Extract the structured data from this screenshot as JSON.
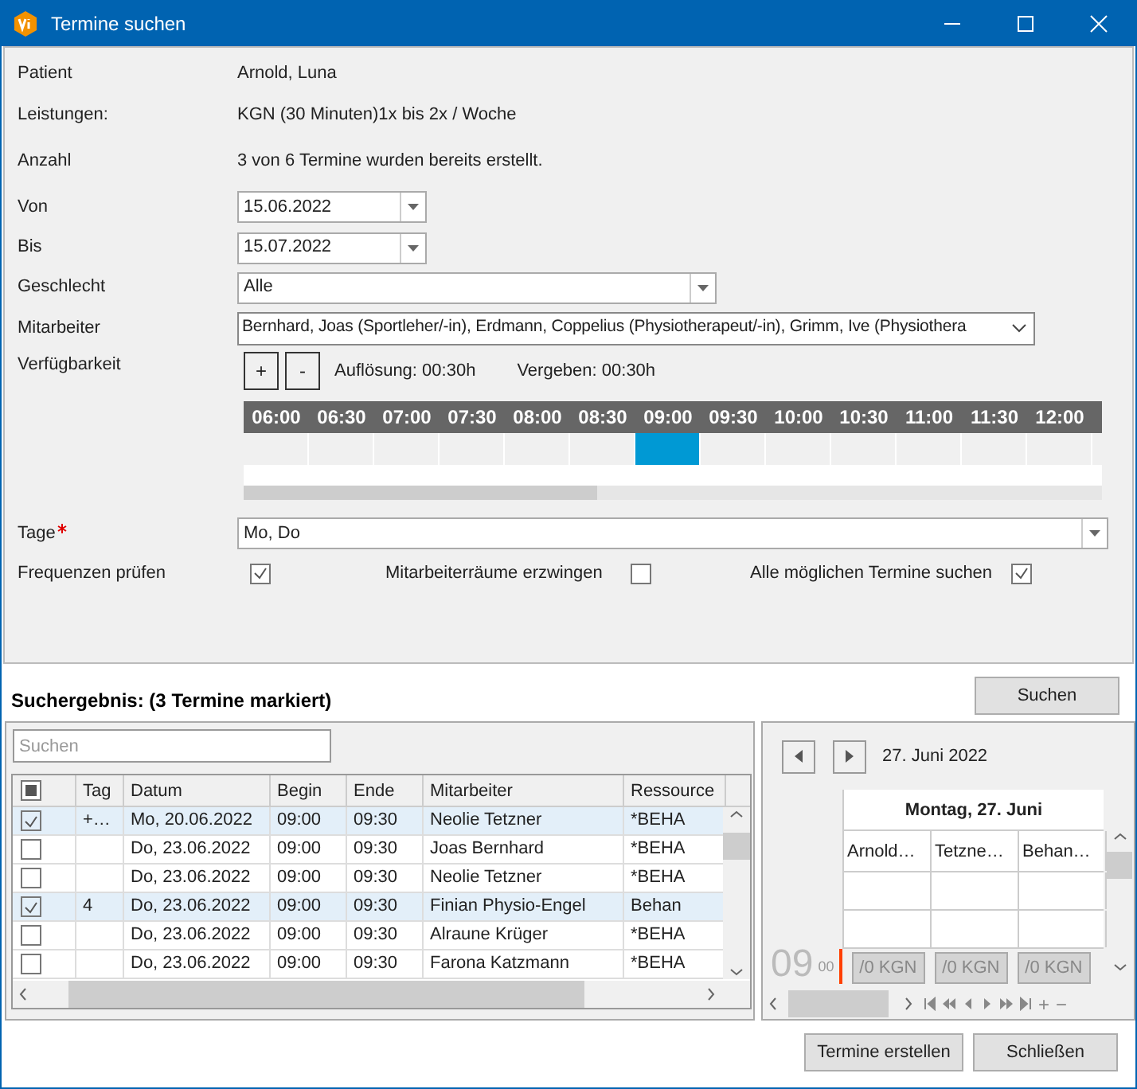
{
  "window": {
    "title": "Termine suchen"
  },
  "info": [
    {
      "label": "Patient",
      "value": "Arnold, Luna"
    },
    {
      "label": "Leistungen:",
      "value": "KGN  (30 Minuten)1x bis 2x / Woche"
    },
    {
      "label": "Anzahl",
      "value": "3 von 6 Termine wurden bereits erstellt."
    }
  ],
  "von": {
    "label": "Von",
    "value": "15.06.2022"
  },
  "bis": {
    "label": "Bis",
    "value": "15.07.2022"
  },
  "geschlecht": {
    "label": "Geschlecht",
    "value": "Alle"
  },
  "mitarbeiter": {
    "label": "Mitarbeiter",
    "value": "Bernhard, Joas (Sportleher/-in), Erdmann, Coppelius (Physiotherapeut/-in), Grimm, Ive (Physiothera"
  },
  "availability": {
    "label": "Verfügbarkeit",
    "buttons": [
      "+",
      "-"
    ],
    "resolution": "Auflösung: 00:30h",
    "assigned": "Vergeben: 00:30h",
    "slots": [
      {
        "time": "06:00",
        "selected": false
      },
      {
        "time": "06:30",
        "selected": false
      },
      {
        "time": "07:00",
        "selected": false
      },
      {
        "time": "07:30",
        "selected": false
      },
      {
        "time": "08:00",
        "selected": false
      },
      {
        "time": "08:30",
        "selected": false
      },
      {
        "time": "09:00",
        "selected": true
      },
      {
        "time": "09:30",
        "selected": false
      },
      {
        "time": "10:00",
        "selected": false
      },
      {
        "time": "10:30",
        "selected": false
      },
      {
        "time": "11:00",
        "selected": false
      },
      {
        "time": "11:30",
        "selected": false
      },
      {
        "time": "12:00",
        "selected": false
      }
    ]
  },
  "tage": {
    "label": "Tage",
    "required": true,
    "value": "Mo, Do"
  },
  "options": [
    {
      "label": "Frequenzen prüfen",
      "checked": true
    },
    {
      "label": "Mitarbeiterräume erzwingen",
      "checked": false
    },
    {
      "label": "Alle möglichen Termine suchen",
      "checked": true
    }
  ],
  "search_button": "Suchen",
  "results": {
    "title": "Suchergebnis: (3 Termine markiert)",
    "search_placeholder": "Suchen",
    "select_all_indeterminate": true,
    "columns": [
      "Tag",
      "Datum",
      "Begin",
      "Ende",
      "Mitarbeiter",
      "Ressource"
    ],
    "rows": [
      {
        "checked": true,
        "cells": [
          "+…",
          "Mo, 20.06.2022",
          "09:00",
          "09:30",
          "Neolie Tetzner",
          "*BEHA"
        ]
      },
      {
        "checked": false,
        "cells": [
          "",
          "Do, 23.06.2022",
          "09:00",
          "09:30",
          "Joas Bernhard",
          "*BEHA"
        ]
      },
      {
        "checked": false,
        "cells": [
          "",
          "Do, 23.06.2022",
          "09:00",
          "09:30",
          "Neolie Tetzner",
          "*BEHA"
        ]
      },
      {
        "checked": true,
        "cells": [
          "4",
          "Do, 23.06.2022",
          "09:00",
          "09:30",
          "Finian Physio-Engel",
          "Behan"
        ]
      },
      {
        "checked": false,
        "cells": [
          "",
          "Do, 23.06.2022",
          "09:00",
          "09:30",
          "Alraune Krüger",
          "*BEHA"
        ]
      },
      {
        "checked": false,
        "cells": [
          "",
          "Do, 23.06.2022",
          "09:00",
          "09:30",
          "Farona Katzmann",
          "*BEHA"
        ]
      }
    ]
  },
  "calendar": {
    "date": "27. Juni 2022",
    "day": "Montag, 27. Juni",
    "resources": [
      "Arnold…",
      "Tetzne…",
      "Behan…"
    ],
    "hour": "09",
    "minute": "00",
    "appointments": [
      "/0 KGN",
      "/0 KGN",
      "/0 KGN"
    ],
    "nav_extra": [
      "+",
      "−"
    ]
  },
  "buttons": [
    "Termine erstellen",
    "Schließen"
  ]
}
